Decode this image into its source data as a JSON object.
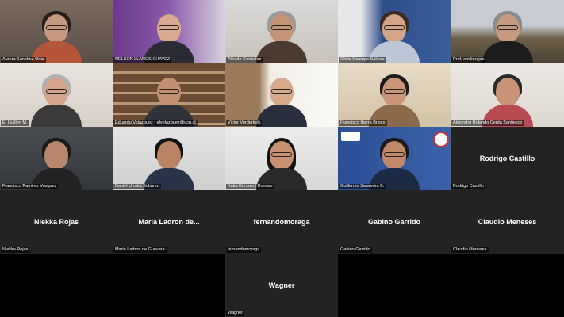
{
  "participants": [
    {
      "name": "Aurora Sanchez Ortiz",
      "type": "video"
    },
    {
      "name": "NELSON LLANOS CHAVEZ",
      "type": "video"
    },
    {
      "name": "Alfredo Gonzalez",
      "type": "video"
    },
    {
      "name": "Olivia Ocampo Salinas",
      "type": "video"
    },
    {
      "name": "Prof. emiliorojas",
      "type": "video"
    },
    {
      "name": "E. Guillen M.",
      "type": "video"
    },
    {
      "name": "Eduardo Velazquez - elvelazquez@ucn.cl",
      "type": "video"
    },
    {
      "name": "Victor Vorderkolk",
      "type": "video"
    },
    {
      "name": "Francisco Ibarra Brisco",
      "type": "video"
    },
    {
      "name": "Alejandro Rolando Cerda Santiesco",
      "type": "video"
    },
    {
      "name": "Francisco Ramirez Vasquez",
      "type": "video"
    },
    {
      "name": "Daniel Urrutia Sobarzo",
      "type": "video"
    },
    {
      "name": "Katia Donoso | Donoso",
      "type": "video"
    },
    {
      "name": "Guillermo Saavedra B.",
      "type": "video"
    },
    {
      "name": "Rodrigo Castillo",
      "display": "Rodrigo Castillo",
      "type": "novideo"
    },
    {
      "name": "Niekka Rojas",
      "display": "Niekka Rojas",
      "type": "novideo"
    },
    {
      "name": "Maria Ladron de Guevara",
      "display": "Maria Ladron de...",
      "type": "novideo"
    },
    {
      "name": "fernandomoraga",
      "display": "fernandomoraga",
      "type": "novideo"
    },
    {
      "name": "Gabino Garrido",
      "display": "Gabino Garrido",
      "type": "novideo"
    },
    {
      "name": "Claudio Meneses",
      "display": "Claudio Meneses",
      "type": "novideo"
    },
    {
      "name": "Wagner",
      "display": "Wagner",
      "type": "novideo"
    }
  ]
}
